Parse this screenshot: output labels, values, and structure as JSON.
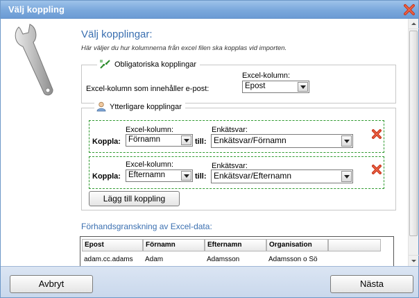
{
  "window": {
    "title": "Välj koppling",
    "close_icon": "close-icon"
  },
  "header": {
    "heading": "Välj kopplingar:",
    "subtitle": "Här väljer du hur kolumnerna från excel filen ska kopplas vid importen."
  },
  "required": {
    "legend": "Obligatoriska kopplingar",
    "column_header": "Excel-kolumn:",
    "email_label": "Excel-kolumn som innehåller e-post:",
    "email_value": "Epost"
  },
  "additional": {
    "legend": "Ytterligare kopplingar",
    "rows": [
      {
        "koppla": "Koppla:",
        "excel_header": "Excel-kolumn:",
        "excel_value": "Förnamn",
        "till": "till:",
        "answer_header": "Enkätsvar:",
        "answer_value": "Enkätsvar/Förnamn"
      },
      {
        "koppla": "Koppla:",
        "excel_header": "Excel-kolumn:",
        "excel_value": "Efternamn",
        "till": "till:",
        "answer_header": "Enkätsvar:",
        "answer_value": "Enkätsvar/Efternamn"
      }
    ],
    "add_button": "Lägg till koppling"
  },
  "preview": {
    "heading": "Förhandsgranskning av Excel-data:",
    "columns": [
      "Epost",
      "Förnamn",
      "Efternamn",
      "Organisation",
      ""
    ],
    "rows": [
      [
        "adam.cc.adams",
        "Adam",
        "Adamsson",
        "Adamsson o Sö"
      ]
    ]
  },
  "footer": {
    "cancel": "Avbryt",
    "next": "Nästa"
  },
  "colors": {
    "accent": "#3a6fb0",
    "titlebar": "#7aa8dc",
    "dashed_border": "#2f9a2f",
    "remove": "#d83a1e"
  }
}
